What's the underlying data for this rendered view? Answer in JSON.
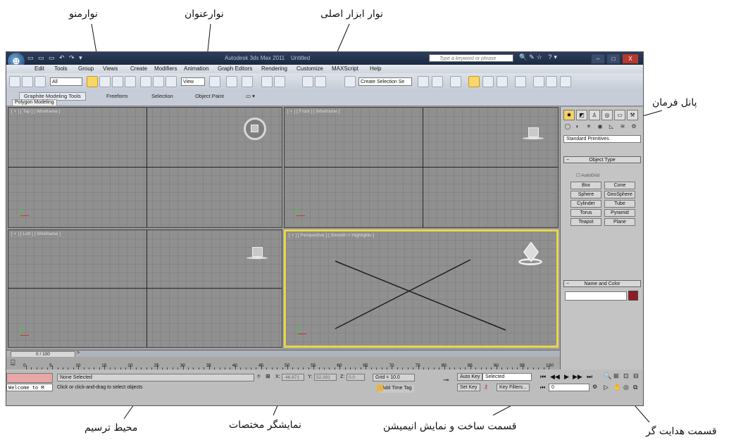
{
  "annotations": {
    "menu_bar": "نوارمنو",
    "title_bar": "نوارعنوان",
    "main_toolbar": "نوار ابزار اصلی",
    "command_panel": "پانل فرمان",
    "drawing_area": "محیط ترسیم",
    "coordinate_display": "نمایشگر مختصات",
    "animation_section": "قسمت ساخت و نمایش انیمیشن",
    "navigation_section": "قسمت هدایت گر"
  },
  "app": {
    "title": "Autodesk 3ds Max 2011",
    "file": "Untitled",
    "search_placeholder": "Type a keyword or phrase",
    "window_controls": {
      "minimize": "–",
      "maximize": "□",
      "close": "X"
    }
  },
  "menu": [
    "Edit",
    "Tools",
    "Group",
    "Views",
    "Create",
    "Modifiers",
    "Animation",
    "Graph Editors",
    "Rendering",
    "Customize",
    "MAXScript",
    "Help"
  ],
  "toolbar": {
    "selection_filter": "All",
    "ref_coord": "View",
    "named_selection": "Create Selection Se"
  },
  "ribbon": {
    "tabs": [
      "Graphite Modeling Tools",
      "Freeform",
      "Selection",
      "Object Paint"
    ],
    "sub_tab": "Polygon Modeling"
  },
  "viewports": [
    {
      "label": "[ + ] [ Top ] [ Wireframe ]"
    },
    {
      "label": "[ + ] [ Front ] [ Wireframe ]"
    },
    {
      "label": "[ + ] [ Left ] [ Wireframe ]"
    },
    {
      "label": "[ + ] [ Perspective ] [ Smooth + Highlights ]"
    }
  ],
  "command_panel": {
    "dropdown": "Standard Primitives",
    "object_type_title": "Object Type",
    "autogrid": "AutoGrid",
    "primitives": [
      "Box",
      "Cone",
      "Sphere",
      "GeoSphere",
      "Cylinder",
      "Tube",
      "Torus",
      "Pyramid",
      "Teapot",
      "Plane"
    ],
    "name_color_title": "Name and Color"
  },
  "timeline": {
    "frame": "0 / 100",
    "ticks": [
      "0",
      "5",
      "10",
      "15",
      "20",
      "25",
      "30",
      "35",
      "40",
      "45",
      "50",
      "55",
      "60",
      "65",
      "70",
      "75",
      "80",
      "85",
      "90",
      "95",
      "100"
    ]
  },
  "status": {
    "listener": "Welcome to M",
    "selection": "None Selected",
    "prompt": "Click or click-and-drag to select objects",
    "x_value": "-46.871",
    "y_value": "52.391",
    "z_value": "0.0",
    "grid": "Grid = 10.0",
    "add_time_tag": "Add Time Tag",
    "auto_key": "Auto Key",
    "auto_key_mode": "Selected",
    "set_key": "Set Key",
    "key_filters": "Key Filters...",
    "current_frame": "0"
  }
}
